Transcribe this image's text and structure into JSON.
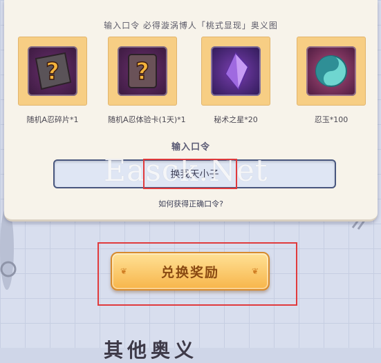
{
  "panel": {
    "title": "输入口令 必得漩涡博人「桃式显现」奥义图"
  },
  "rewards": [
    {
      "label": "随机A忍碎片*1",
      "icon": "mystery-shard-icon"
    },
    {
      "label": "随机A忍体验卡(1天)*1",
      "icon": "mystery-card-icon"
    },
    {
      "label": "秘术之星*20",
      "icon": "purple-crystal-icon"
    },
    {
      "label": "忍玉*100",
      "icon": "ninja-jade-icon"
    }
  ],
  "code": {
    "label": "输入口令",
    "value": "换我天小子"
  },
  "help": {
    "text": "如何获得正确口令?"
  },
  "redeem": {
    "label": "兑换奖励"
  },
  "watermark": "Easck.Net",
  "footer": {
    "title": "其他奥义"
  },
  "colors": {
    "highlight_box": "#e0393b",
    "button": "#f7b54a",
    "input_border": "#48567e"
  }
}
